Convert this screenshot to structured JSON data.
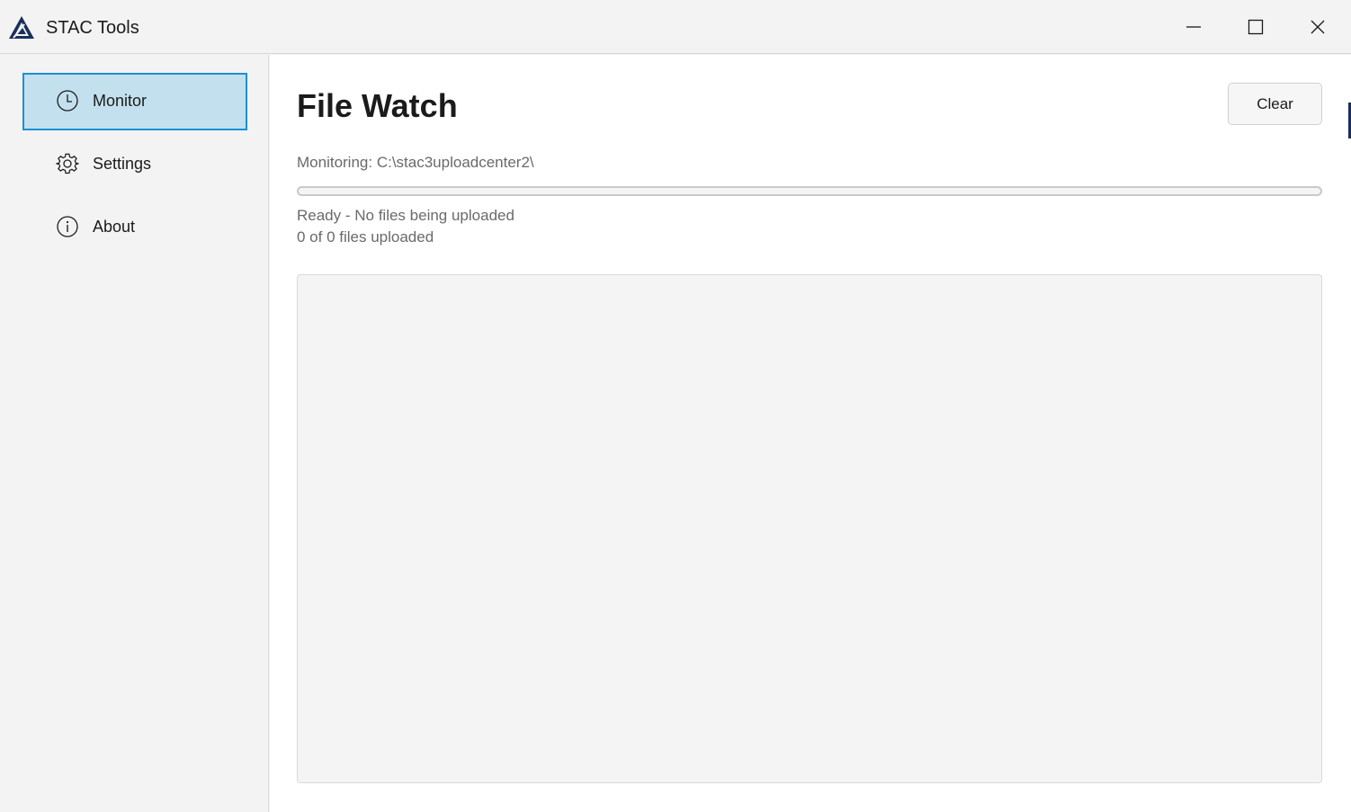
{
  "app": {
    "title": "STAC Tools",
    "logo_icon": "stac-logo-icon"
  },
  "window_controls": {
    "minimize_icon": "minimize-icon",
    "maximize_icon": "maximize-icon",
    "close_icon": "close-icon"
  },
  "sidebar": {
    "items": [
      {
        "label": "Monitor",
        "icon": "clock-icon",
        "active": true
      },
      {
        "label": "Settings",
        "icon": "gear-icon",
        "active": false
      },
      {
        "label": "About",
        "icon": "info-icon",
        "active": false
      }
    ]
  },
  "main": {
    "title": "File Watch",
    "clear_label": "Clear",
    "monitoring_text": "Monitoring: C:\\stac3uploadcenter2\\",
    "progress_percent": 0,
    "status_text": "Ready - No files being uploaded",
    "count_text": "0 of 0 files uploaded",
    "log_entries": []
  },
  "colors": {
    "accent": "#1c8fd6",
    "active_nav_bg": "#c3e0ee",
    "logo": "#1a2f5a"
  }
}
